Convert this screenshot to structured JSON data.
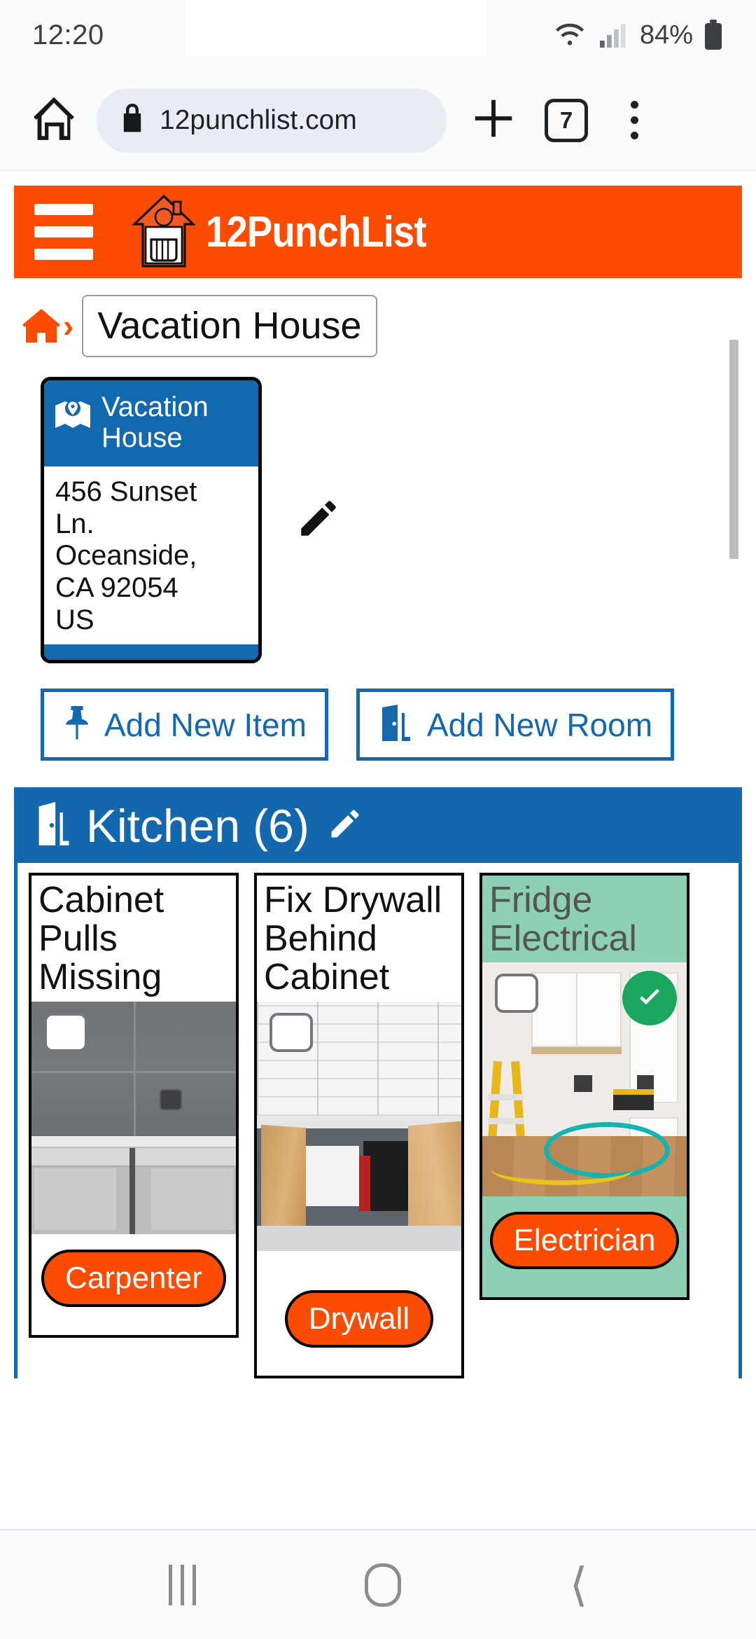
{
  "status_bar": {
    "time": "12:20",
    "battery_percent": "84%",
    "wifi_icon": "wifi-icon",
    "signal_icon": "cellular-signal-icon",
    "battery_icon": "battery-icon"
  },
  "browser": {
    "home_icon": "home-icon",
    "lock_icon": "lock-icon",
    "url": "12punchlist.com",
    "new_tab_icon": "plus-icon",
    "tab_count": "7",
    "menu_icon": "overflow-menu-icon"
  },
  "app_header": {
    "menu_icon": "hamburger-menu-icon",
    "logo_icon": "house-fist-logo-icon",
    "brand": "12PunchList",
    "background_color": "#fc4c02"
  },
  "breadcrumb": {
    "home_icon": "home-icon",
    "separator": "›",
    "current": "Vacation House"
  },
  "property_card": {
    "map_icon": "map-marker-icon",
    "name": "Vacation House",
    "address_lines": [
      "456 Sunset",
      "Ln.",
      "Oceanside,",
      "CA 92054",
      "US"
    ],
    "edit_icon": "pencil-edit-icon",
    "header_color": "#1369ae"
  },
  "actions": [
    {
      "icon": "pushpin-icon",
      "label": "Add New Item"
    },
    {
      "icon": "door-icon",
      "label": "Add New Room"
    }
  ],
  "room": {
    "icon": "door-icon",
    "name": "Kitchen",
    "count": "(6)",
    "edit_icon": "pencil-edit-icon",
    "header_color": "#1368ad"
  },
  "items": [
    {
      "title": "Cabinet Pulls Missing",
      "checkbox_icon": "checkbox-unchecked-icon",
      "trade": "Carpenter",
      "completed": false,
      "photo_alt": "gray tile backsplash above gray base cabinets"
    },
    {
      "title": "Fix Drywall Behind Cabinet",
      "checkbox_icon": "checkbox-unchecked-icon",
      "trade": "Drywall",
      "completed": false,
      "photo_alt": "open wood cabinet doors showing wall behind"
    },
    {
      "title": "Fridge Electrical",
      "checkbox_icon": "checkbox-unchecked-icon",
      "trade": "Electrician",
      "completed": true,
      "completed_icon": "check-circle-icon",
      "photo_alt": "kitchen fridge alcove with yellow ladder and cords"
    }
  ],
  "colors": {
    "brand_orange": "#fc4c02",
    "brand_blue": "#1368ad",
    "completed_green": "#8ed0b4",
    "check_badge_green": "#19a75f"
  },
  "system_nav": {
    "recents_icon": "recents-icon",
    "home_icon": "home-pill-icon",
    "back_icon": "back-chevron-icon"
  }
}
